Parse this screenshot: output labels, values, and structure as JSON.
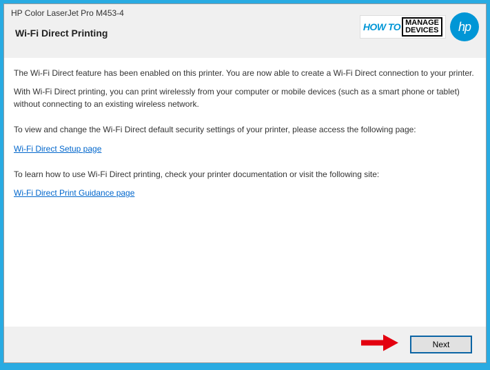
{
  "window": {
    "title": "HP Color LaserJet Pro M453-4"
  },
  "header": {
    "page_title": "Wi-Fi Direct Printing",
    "badge_howto": "HOW TO",
    "badge_manage": "MANAGE",
    "badge_devices": "DEVICES",
    "hp_label": "hp"
  },
  "content": {
    "p1": "The Wi-Fi Direct feature has been enabled on this printer. You are now able to create a Wi-Fi Direct connection to your printer.",
    "p2": "With Wi-Fi Direct printing, you can print wirelessly from your computer or mobile devices (such as a smart phone or tablet) without connecting to an existing wireless network.",
    "p3": "To view and change the Wi-Fi Direct default security settings of your printer, please access the following page:",
    "link1": "Wi-Fi Direct Setup page",
    "p4": "To learn how to use Wi-Fi Direct printing, check your printer documentation or visit the following site:",
    "link2": "Wi-Fi Direct Print Guidance page"
  },
  "footer": {
    "next_label": "Next"
  }
}
